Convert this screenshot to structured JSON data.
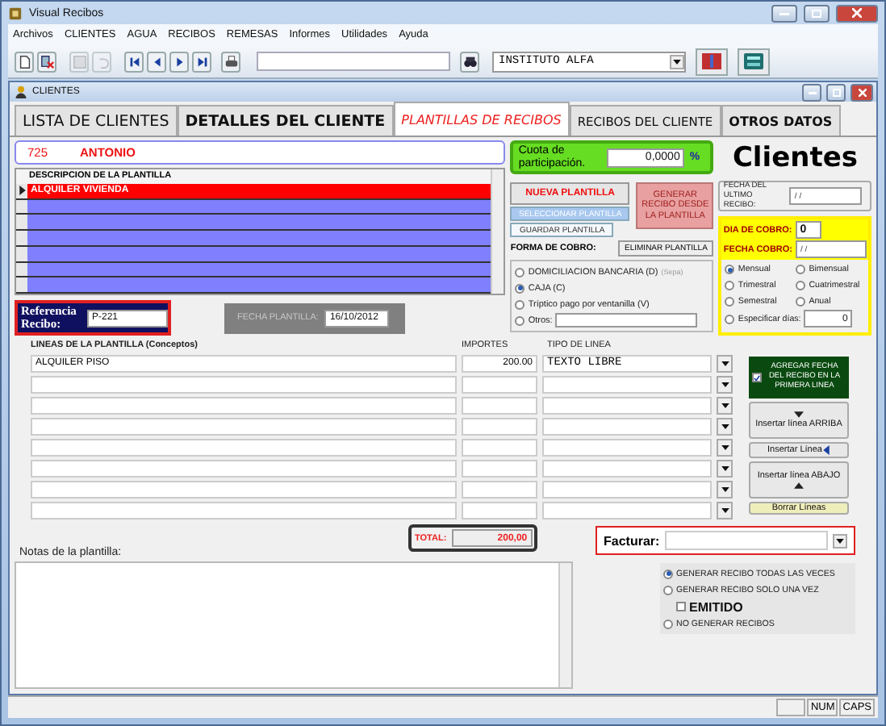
{
  "window": {
    "title": "Visual Recibos"
  },
  "menu": [
    "Archivos",
    "CLIENTES",
    "AGUA",
    "RECIBOS",
    "REMESAS",
    "Informes",
    "Utilidades",
    "Ayuda"
  ],
  "toolbar": {
    "company": "INSTITUTO ALFA"
  },
  "child_window": {
    "title": "CLIENTES"
  },
  "tabs": [
    {
      "label": "LISTA DE CLIENTES",
      "selected": false
    },
    {
      "label": "DETALLES DEL CLIENTE",
      "selected": false
    },
    {
      "label": "PLANTILLAS DE RECIBOS",
      "selected": true
    },
    {
      "label": "RECIBOS DEL CLIENTE",
      "selected": false
    },
    {
      "label": "OTROS DATOS",
      "selected": false
    }
  ],
  "client": {
    "code": "725",
    "name": "ANTONIO"
  },
  "templates": {
    "column": "DESCRIPCION DE LA PLANTILLA",
    "rows": [
      {
        "text": "ALQUILER VIVIENDA",
        "selected": true
      }
    ]
  },
  "reference": {
    "label": "Referencia Recibo:",
    "value": "P-221"
  },
  "template_date": {
    "label": "FECHA PLANTILLA:",
    "value": "16/10/2012"
  },
  "quota": {
    "label": "Cuota de participación.",
    "value": "0,0000",
    "unit": "%"
  },
  "template_buttons": {
    "new": "NUEVA PLANTILLA",
    "select": "SELECCIONAR PLANTILLA",
    "save": "GUARDAR PLANTILLA",
    "delete": "ELIMINAR PLANTILLA",
    "generate": "GENERAR RECIBO DESDE LA PLANTILLA"
  },
  "payment": {
    "label": "FORMA DE COBRO:",
    "options": [
      {
        "label": "DOMICILIACION BANCARIA (D)",
        "note": "(Sepa)",
        "selected": false,
        "kind": "plain"
      },
      {
        "label": "CAJA (C)",
        "selected": true,
        "kind": "plain"
      },
      {
        "label": "Tríptico pago por ventanilla (V)",
        "selected": false,
        "kind": "plain"
      },
      {
        "label": "Otros:",
        "selected": false,
        "kind": "field"
      }
    ]
  },
  "brand": "Clientes",
  "last_receipt": {
    "label": "FECHA DEL ULTIMO RECIBO:",
    "value": "/ /"
  },
  "billing_day": {
    "label": "DIA DE COBRO:",
    "value": "0"
  },
  "billing_date": {
    "label": "FECHA COBRO:",
    "value": "/ /"
  },
  "periods": [
    {
      "label": "Mensual",
      "selected": true
    },
    {
      "label": "Bimensual",
      "selected": false
    },
    {
      "label": "Trimestral",
      "selected": false
    },
    {
      "label": "Cuatrimestral",
      "selected": false
    },
    {
      "label": "Semestral",
      "selected": false
    },
    {
      "label": "Anual",
      "selected": false
    }
  ],
  "custom_days": {
    "label": "Especificar días:",
    "value": "0",
    "selected": false
  },
  "lines": {
    "columns": [
      "LINEAS DE LA PLANTILLA (Conceptos)",
      "IMPORTES",
      "TIPO DE LINEA"
    ],
    "rows": [
      {
        "concept": "ALQUILER PISO",
        "amount": "200.00",
        "type": "TEXTO LIBRE"
      }
    ]
  },
  "add_date": {
    "label": "AGREGAR FECHA DEL RECIBO EN LA PRIMERA LINEA",
    "checked": true
  },
  "line_buttons": [
    {
      "label": "Insertar línea ARRIBA",
      "kind": "above"
    },
    {
      "label": "Insertar Línea",
      "kind": "here"
    },
    {
      "label": "Insertar línea ABAJO",
      "kind": "below"
    },
    {
      "label": "Borrar Líneas",
      "kind": "delete"
    }
  ],
  "total": {
    "label": "TOTAL:",
    "value": "200,00"
  },
  "invoice": {
    "label": "Facturar:"
  },
  "notes": {
    "label": "Notas de la plantilla:"
  },
  "generation": [
    {
      "label": "GENERAR RECIBO TODAS LAS VECES",
      "selected": true
    },
    {
      "label": "GENERAR RECIBO SOLO UNA VEZ",
      "selected": false
    },
    {
      "label": "NO GENERAR RECIBOS",
      "selected": false
    }
  ],
  "issued": {
    "label": "EMITIDO",
    "checked": false
  },
  "status_bar": [
    "NUM",
    "CAPS"
  ]
}
